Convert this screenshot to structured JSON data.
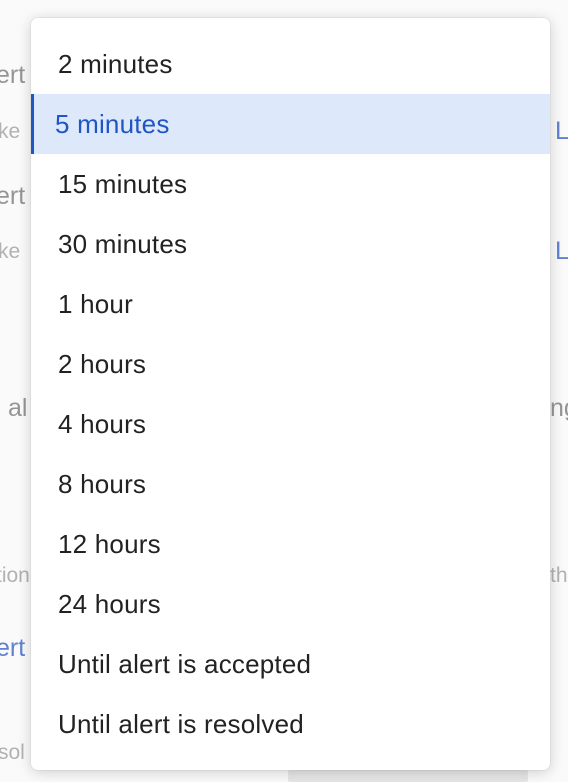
{
  "background": {
    "fragments": [
      {
        "text": "ert",
        "name": "bg-text-alert-1"
      },
      {
        "text": "ke",
        "name": "bg-text-linked-1"
      },
      {
        "text": "L",
        "name": "bg-link-1"
      },
      {
        "text": "ert",
        "name": "bg-text-alert-2"
      },
      {
        "text": "ke",
        "name": "bg-text-linked-2"
      },
      {
        "text": "L",
        "name": "bg-link-2"
      },
      {
        "text": "al",
        "name": "bg-text-al"
      },
      {
        "text": "ng",
        "name": "bg-text-ng"
      },
      {
        "text": "tion",
        "name": "bg-text-tion"
      },
      {
        "text": "th",
        "name": "bg-text-th"
      },
      {
        "text": "ert",
        "name": "bg-link-alert"
      },
      {
        "text": "sol",
        "name": "bg-text-sol"
      }
    ]
  },
  "dropdown": {
    "selected_index": 1,
    "options": [
      "2 minutes",
      "5 minutes",
      "15 minutes",
      "30 minutes",
      "1 hour",
      "2 hours",
      "4 hours",
      "8 hours",
      "12 hours",
      "24 hours",
      "Until alert is accepted",
      "Until alert is resolved"
    ]
  },
  "colors": {
    "selected_background": "#dde9fb",
    "selected_text": "#1f56c4",
    "option_text": "#222222",
    "background_link": "#1e4fbf"
  }
}
